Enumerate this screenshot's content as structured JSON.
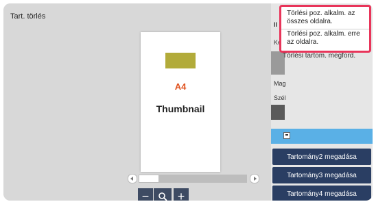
{
  "header": {
    "title": "Tart. törlés"
  },
  "preview": {
    "page_size": "A4",
    "thumbnail_label": "Thumbnail",
    "swatch_color": "#b2ab3a"
  },
  "zoom": {
    "minus": "−",
    "plus": "+"
  },
  "right_panel": {
    "frag_top": "II",
    "frag_ke": "Ke",
    "frag_mag": "Mag",
    "frag_szel": "Szél",
    "under_text": "Törlési tartom. megford.",
    "range_buttons": [
      "Tartomány2 megadása",
      "Tartomány3 megadása",
      "Tartomány4 megadása"
    ]
  },
  "popup": {
    "option1": "Törlési poz. alkalm. az összes oldalra.",
    "option2": "Törlési poz. alkalm. erre az oldalra."
  },
  "colors": {
    "accent_border": "#e8355a",
    "button_bg": "#2a3e63",
    "selected_bar": "#5ab0e6"
  }
}
